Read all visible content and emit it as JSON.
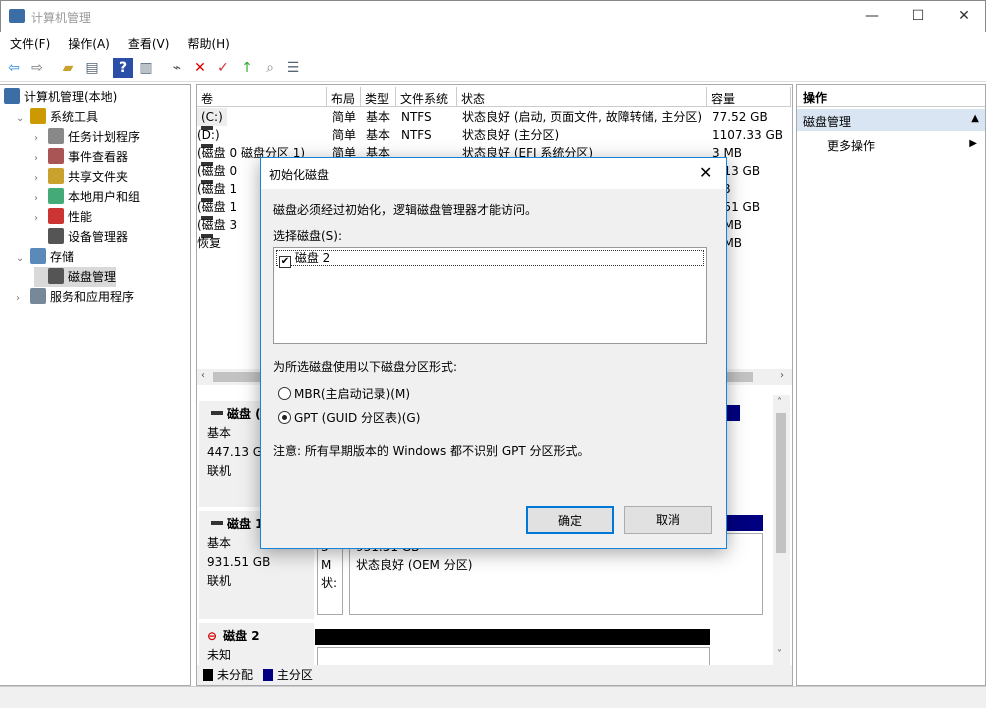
{
  "window": {
    "title": "计算机管理",
    "minimize": "—",
    "maximize": "☐",
    "close": "✕"
  },
  "menu": [
    "文件(F)",
    "操作(A)",
    "查看(V)",
    "帮助(H)"
  ],
  "toolbar": [
    "back-icon",
    "forward-icon",
    "up-folder-icon",
    "show-hide-tree-icon",
    "help-icon",
    "show-action-pane-icon",
    "connect-icon",
    "delete-icon",
    "properties-icon",
    "export-icon",
    "search-icon",
    "list-icon"
  ],
  "tree": [
    {
      "label": "计算机管理(本地)",
      "level": 0,
      "arrow": ""
    },
    {
      "label": "系统工具",
      "level": 1,
      "arrow": "⌄"
    },
    {
      "label": "任务计划程序",
      "level": 2,
      "arrow": "›"
    },
    {
      "label": "事件查看器",
      "level": 2,
      "arrow": "›"
    },
    {
      "label": "共享文件夹",
      "level": 2,
      "arrow": "›"
    },
    {
      "label": "本地用户和组",
      "level": 2,
      "arrow": "›"
    },
    {
      "label": "性能",
      "level": 2,
      "arrow": "›"
    },
    {
      "label": "设备管理器",
      "level": 2,
      "arrow": ""
    },
    {
      "label": "存储",
      "level": 1,
      "arrow": "⌄"
    },
    {
      "label": "磁盘管理",
      "level": 2,
      "arrow": "",
      "selected": true
    },
    {
      "label": "服务和应用程序",
      "level": 1,
      "arrow": "›"
    }
  ],
  "volumes": {
    "columns": [
      "卷",
      "布局",
      "类型",
      "文件系统",
      "状态",
      "容量"
    ],
    "rows": [
      [
        "(C:)",
        "简单",
        "基本",
        "NTFS",
        "状态良好 (启动, 页面文件, 故障转储, 主分区)",
        "77.52 GB"
      ],
      [
        "(D:)",
        "简单",
        "基本",
        "NTFS",
        "状态良好 (主分区)",
        "1107.33 GB"
      ],
      [
        "(磁盘 0 磁盘分区 1)",
        "简单",
        "基本",
        "",
        "状态良好 (EFI 系统分区)",
        "3 MB"
      ],
      [
        "(磁盘 0",
        "",
        "",
        "",
        "",
        "7.13 GB"
      ],
      [
        "(磁盘 1",
        "",
        "",
        "",
        "",
        "MB"
      ],
      [
        "(磁盘 1",
        "",
        "",
        "",
        "",
        "1.51 GB"
      ],
      [
        "(磁盘 3",
        "",
        "",
        "",
        "",
        "0 MB"
      ],
      [
        "恢复",
        "",
        "",
        "",
        "",
        "9 MB"
      ]
    ]
  },
  "disks": [
    {
      "name": "磁盘 (",
      "type": "基本",
      "size": "447.13 GB",
      "state": "联机"
    },
    {
      "name": "磁盘 1",
      "type": "基本",
      "size": "931.51 GB",
      "state": "联机",
      "part_small_size": "3 M",
      "part_small_status": "状:",
      "part_size": "931.51 GB",
      "part_status": "状态良好 (OEM 分区)"
    },
    {
      "name": "磁盘 2",
      "type": "未知"
    }
  ],
  "legend": [
    {
      "label": "未分配",
      "color": "#000000"
    },
    {
      "label": "主分区",
      "color": "#000080"
    }
  ],
  "actions": {
    "header": "操作",
    "section": "磁盘管理",
    "more": "更多操作"
  },
  "dialog": {
    "title": "初始化磁盘",
    "message": "磁盘必须经过初始化，逻辑磁盘管理器才能访问。",
    "select_label": "选择磁盘(S):",
    "disks": [
      {
        "label": "磁盘 2",
        "checked": true
      }
    ],
    "style_label": "为所选磁盘使用以下磁盘分区形式:",
    "mbr": "MBR(主启动记录)(M)",
    "gpt": "GPT (GUID 分区表)(G)",
    "selected": "gpt",
    "note": "注意: 所有早期版本的 Windows 都不识别 GPT 分区形式。",
    "ok": "确定",
    "cancel": "取消"
  },
  "colors": {
    "accent": "#1883d7",
    "primary_partition": "#000080",
    "unallocated": "#000000",
    "selection": "#cce8ff"
  }
}
